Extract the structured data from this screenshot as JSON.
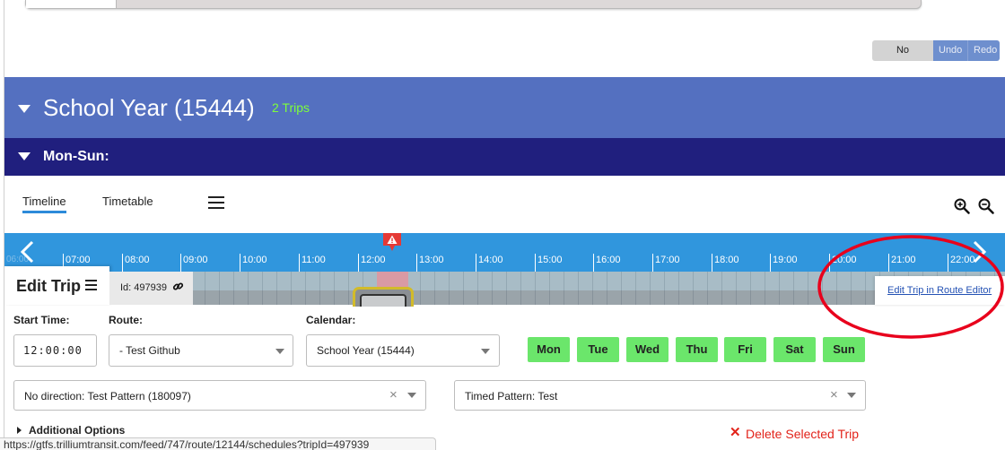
{
  "changes": {
    "status": "No Changes",
    "undo": "Undo",
    "redo": "Redo"
  },
  "group": {
    "title": "School Year (15444)",
    "trip_count": "2 Trips"
  },
  "calendar_section": {
    "title": "Mon-Sun:"
  },
  "tabs": {
    "timeline": "Timeline",
    "timetable": "Timetable"
  },
  "icons": {
    "menu": "menu-icon",
    "zoom_in": "zoom-in-icon",
    "zoom_out": "zoom-out-icon",
    "link": "link-icon",
    "warning": "warning-icon"
  },
  "timeline": {
    "first_partial_hour": "06:00",
    "hours": [
      "07:00",
      "08:00",
      "09:00",
      "10:00",
      "11:00",
      "12:00",
      "13:00",
      "14:00",
      "15:00",
      "16:00",
      "17:00",
      "18:00",
      "19:00",
      "20:00",
      "21:00",
      "22:00"
    ],
    "accent_color": "#3096dd",
    "warning_color": "#e53935"
  },
  "edit_trip": {
    "title": "Edit Trip",
    "id_label": "Id: 497939",
    "route_editor_link": "Edit Trip in Route Editor"
  },
  "form": {
    "start_time_label": "Start Time:",
    "start_time_value": "12:00:00",
    "route_label": "Route:",
    "route_value": "- Test Github",
    "calendar_label": "Calendar:",
    "calendar_value": "School Year (15444)",
    "days": [
      "Mon",
      "Tue",
      "Wed",
      "Thu",
      "Fri",
      "Sat",
      "Sun"
    ],
    "direction_value": "No direction: Test Pattern (180097)",
    "pattern_value": "Timed Pattern: Test",
    "additional_options": "Additional Options",
    "delete_trip": "Delete Selected Trip"
  },
  "status_bar": {
    "url": "https://gtfs.trilliumtransit.com/feed/747/route/12144/schedules?tripId=497939"
  },
  "colors": {
    "header_blue": "#5470c0",
    "header_navy": "#201f7e",
    "trip_count_green": "#7dff3a",
    "day_green": "#6be66b",
    "delete_red": "#e2231a",
    "annotation_red": "#e8001c"
  }
}
